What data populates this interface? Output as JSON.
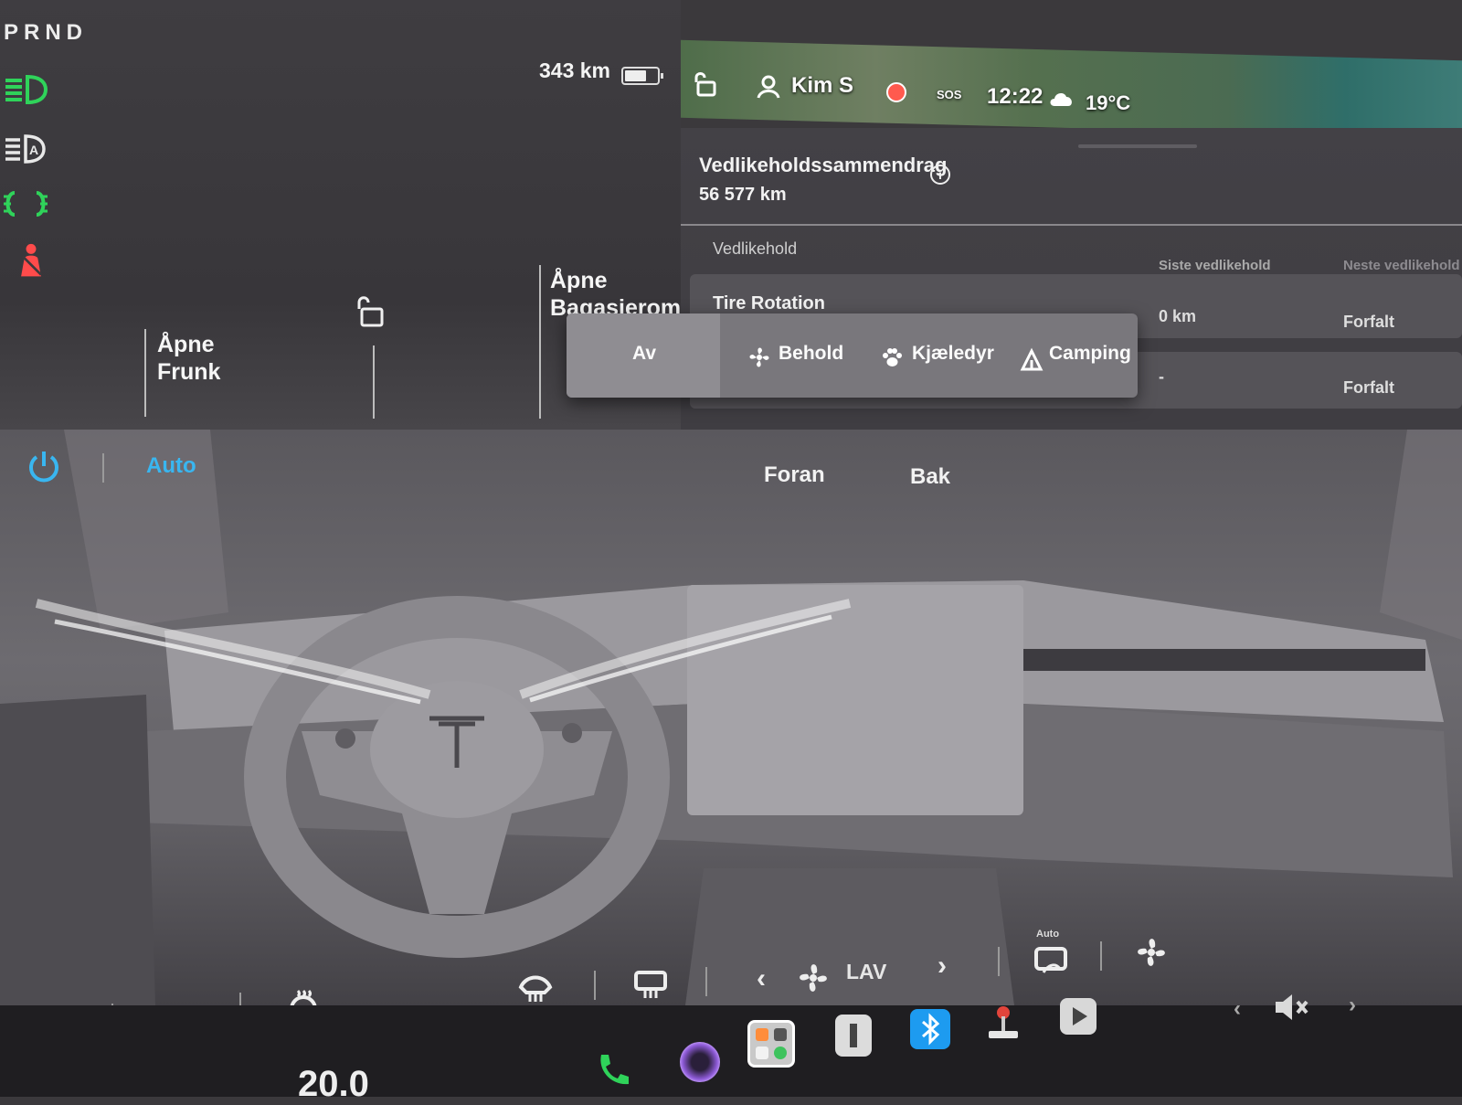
{
  "drive": {
    "gears": "PRND"
  },
  "status_bar": {
    "range": "343 km",
    "user": "Kim S",
    "sos": "SOS",
    "time": "12:22",
    "temperature": "19°C"
  },
  "doors": {
    "frunk_label": "Åpne\nFrunk",
    "trunk_label": "Åpne\nBagasjerom"
  },
  "maintenance": {
    "title": "Vedlikeholdssammendrag",
    "odometer": "56 577  km",
    "section": "Vedlikehold",
    "columns": [
      "Siste vedlikehold",
      "Neste vedlikehold"
    ],
    "rows": [
      {
        "name": "Tire Rotation",
        "last": "0 km",
        "next": "Forfalt"
      },
      {
        "name": "",
        "last": "-",
        "next": "Forfalt"
      }
    ]
  },
  "climate_keeper_menu": {
    "selected": "Av",
    "options": [
      "Av",
      "Behold",
      "Kjæledyr",
      "Camping"
    ]
  },
  "climate": {
    "auto_label": "Auto",
    "front_label": "Foran",
    "rear_label": "Bak",
    "fan_speed": "LAV",
    "recirc_label": "Auto"
  },
  "bottom": {
    "speed_partial": "20.0"
  },
  "colors": {
    "accent_blue": "#39b6f0",
    "indicator_green": "#2fd35a",
    "warning_red": "#ff4b4b"
  }
}
